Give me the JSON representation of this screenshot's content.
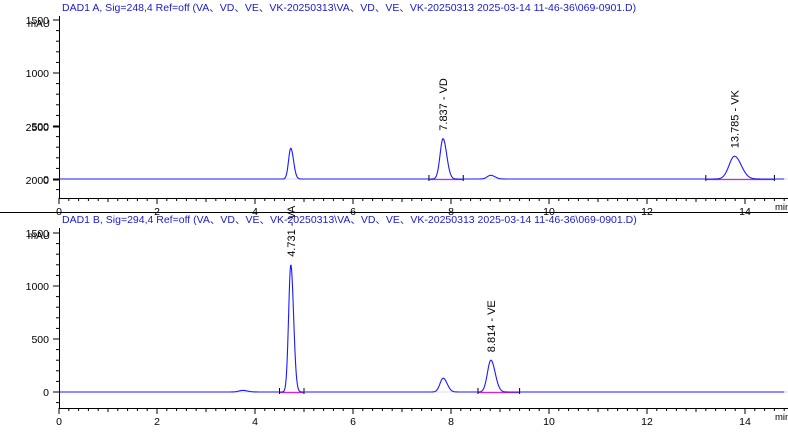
{
  "chart_data": [
    {
      "type": "line",
      "title": "DAD1 A, Sig=248,4 Ref=off (VA、VD、VE、VK-20250313\\VA、VD、VE、VK-20250313 2025-03-14 11-46-36\\069-0901.D)",
      "ylabel": "mAU",
      "xlabel": "min",
      "xlim": [
        0,
        14.8
      ],
      "ylim": [
        -200,
        3000
      ],
      "x_ticks": [
        "0",
        "2",
        "4",
        "6",
        "8",
        "10",
        "12",
        "14"
      ],
      "y_ticks": [
        "0",
        "500",
        "1000",
        "1500",
        "2000",
        "2500"
      ],
      "colors": {
        "signal": "#1a1aff",
        "baseline": "#e020c8",
        "title": "#1a1acc",
        "axis": "#000000"
      },
      "peaks": [
        {
          "rt": 4.73,
          "height": 290,
          "width": 0.045,
          "label": ""
        },
        {
          "rt": 7.837,
          "height": 380,
          "width": 0.06,
          "label": "7.837 - VD"
        },
        {
          "rt": 8.81,
          "height": 35,
          "width": 0.07,
          "label": ""
        },
        {
          "rt": 13.785,
          "height": 215,
          "width": 0.11,
          "label": "13.785 - VK"
        }
      ],
      "baseline_segments": [
        [
          7.55,
          8.25
        ],
        [
          13.2,
          14.6
        ]
      ]
    },
    {
      "type": "line",
      "title": "DAD1 B, Sig=294,4 Ref=off (VA、VD、VE、VK-20250313\\VA、VD、VE、VK-20250313 2025-03-14 11-46-36\\069-0901.D)",
      "ylabel": "mAU",
      "xlabel": "min",
      "xlim": [
        0,
        14.8
      ],
      "ylim": [
        -200,
        3000
      ],
      "x_ticks": [
        "0",
        "2",
        "4",
        "6",
        "8",
        "10",
        "12",
        "14"
      ],
      "y_ticks": [
        "0",
        "500",
        "1000",
        "1500",
        "2000",
        "2500"
      ],
      "colors": {
        "signal": "#1a1aff",
        "baseline": "#e020c8",
        "title": "#1a1acc",
        "axis": "#000000"
      },
      "peaks": [
        {
          "rt": 3.75,
          "height": 15,
          "width": 0.08,
          "label": ""
        },
        {
          "rt": 4.731,
          "height": 1200,
          "width": 0.045,
          "label": "4.731 - VA"
        },
        {
          "rt": 7.84,
          "height": 130,
          "width": 0.065,
          "label": ""
        },
        {
          "rt": 8.814,
          "height": 300,
          "width": 0.07,
          "label": "8.814 - VE"
        }
      ],
      "baseline_segments": [
        [
          4.5,
          5.0
        ],
        [
          8.55,
          9.4
        ]
      ]
    }
  ]
}
